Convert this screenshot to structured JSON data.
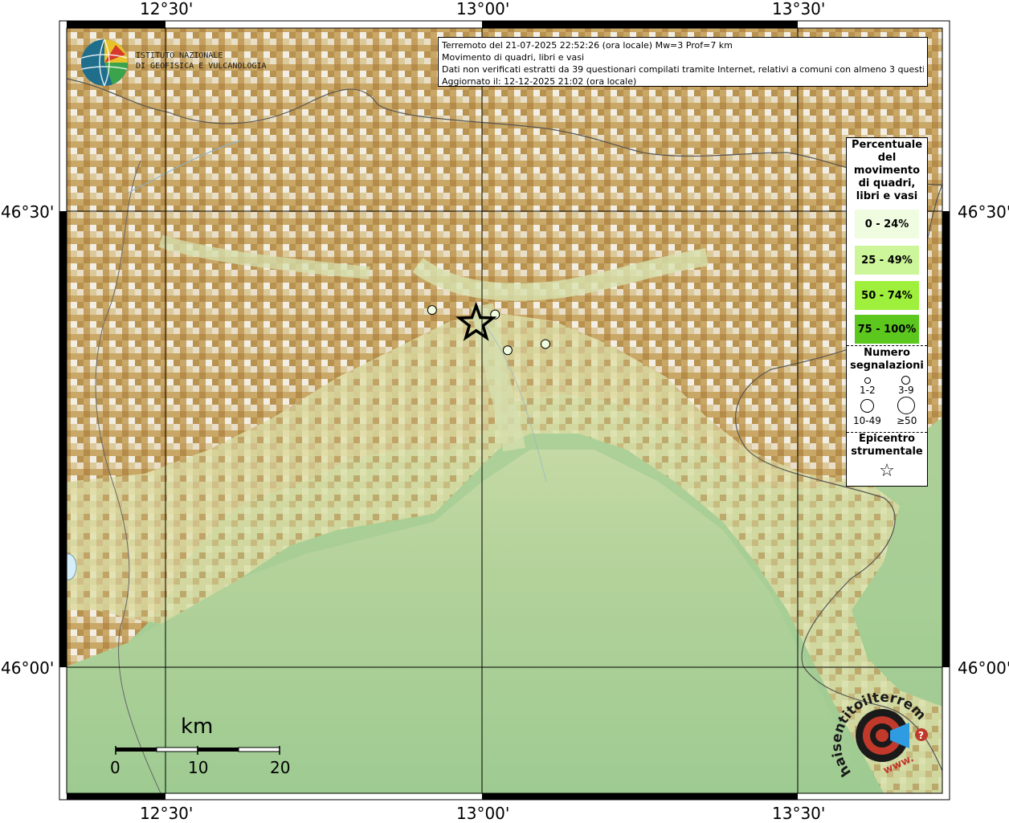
{
  "info": {
    "line1": "Terremoto del 21-07-2025 22:52:26 (ora locale) Mw=3 Prof=7 km",
    "line2": "Movimento di quadri, libri e vasi",
    "line3": "Dati non verificati estratti da 39 questionari compilati tramite Internet, relativi a comuni con almeno 3 questionari.",
    "line4": "Aggiornato il: 12-12-2025 21:02 (ora locale)"
  },
  "ticks": {
    "top": [
      "12°30'",
      "13°00'",
      "13°30'"
    ],
    "bottom": [
      "12°30'",
      "13°00'",
      "13°30'"
    ],
    "left": [
      "46°30'",
      "46°00'"
    ],
    "right": [
      "46°30'",
      "46°00'"
    ]
  },
  "logo": {
    "ingv_line1": "ISTITUTO NAZIONALE",
    "ingv_line2": "DI GEOFISICA E VULCANOLOGIA",
    "hst_text": "haisentitoilterremoto.it",
    "hst_prefix": "www."
  },
  "legend": {
    "title": "Percentuale\ndel\nmovimento\ndi quadri,\nlibri e vasi",
    "classes": [
      {
        "label": "0 - 24%",
        "color": "#f0fce0"
      },
      {
        "label": "25 - 49%",
        "color": "#cdf59a"
      },
      {
        "label": "50 - 74%",
        "color": "#9ff03c"
      },
      {
        "label": "75 - 100%",
        "color": "#5cc81e"
      }
    ],
    "count_title": "Numero\nsegnalazioni",
    "counts": [
      "1-2",
      "3-9",
      "10-49",
      "≥50"
    ],
    "epicenter_title": "Epicentro\nstrumentale",
    "epicenter_symbol": "☆"
  },
  "scale": {
    "unit": "km",
    "labels": [
      "0",
      "10",
      "20"
    ]
  },
  "map": {
    "epicenter": {
      "lon": 12.99,
      "lat": 46.385
    },
    "lon_range": [
      12.34,
      13.73
    ],
    "lat_range": [
      45.86,
      46.715
    ],
    "points": [
      {
        "lon": 12.92,
        "lat": 46.4,
        "cls": "0 - 24%",
        "count": "3-9"
      },
      {
        "lon": 13.02,
        "lat": 46.395,
        "cls": "0 - 24%",
        "count": "3-9"
      },
      {
        "lon": 13.04,
        "lat": 46.355,
        "cls": "0 - 24%",
        "count": "3-9"
      },
      {
        "lon": 13.1,
        "lat": 46.362,
        "cls": "0 - 24%",
        "count": "3-9"
      }
    ]
  }
}
